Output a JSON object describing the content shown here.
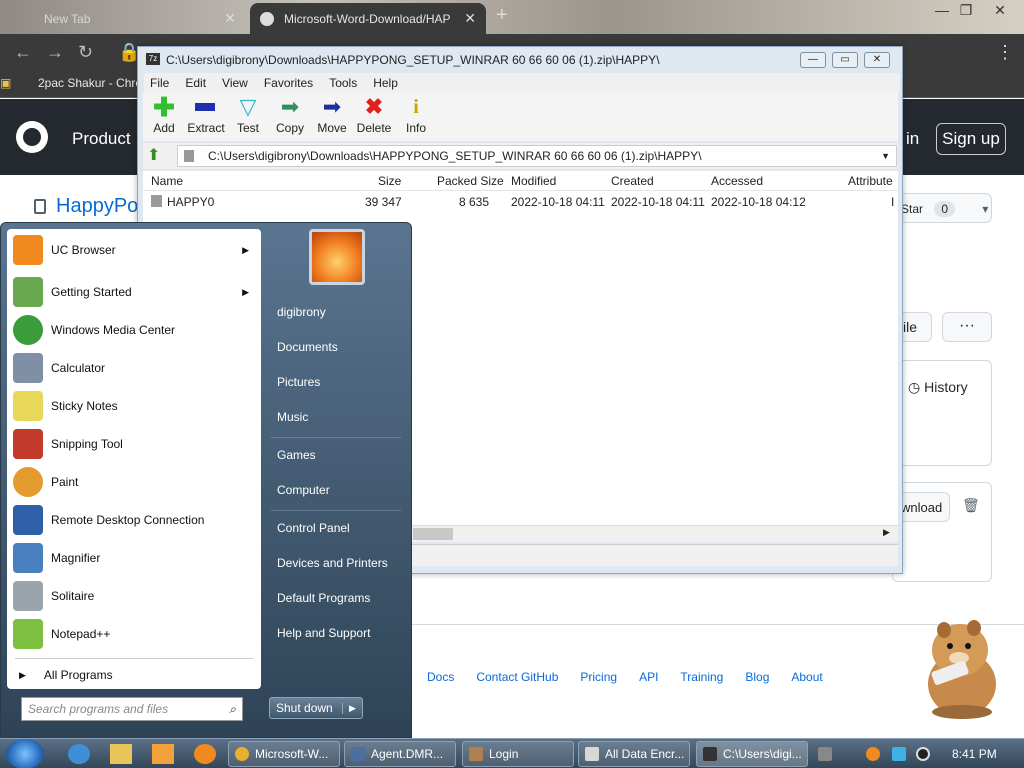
{
  "browser": {
    "tabs": [
      {
        "title": "New Tab"
      },
      {
        "title": "Microsoft-Word-Download/HAP"
      }
    ],
    "bookmarks": [
      {
        "label": "2pac Shakur - Chro"
      }
    ]
  },
  "github": {
    "nav_product": "Product",
    "sign_in": "in",
    "sign_up": "Sign up",
    "repo_name": "HappyPo",
    "star_label": "Star",
    "star_count": "0",
    "file_button": "ile",
    "history": "History",
    "download": "wnload",
    "footer_links": [
      "Docs",
      "Contact GitHub",
      "Pricing",
      "API",
      "Training",
      "Blog",
      "About"
    ]
  },
  "sevenzip": {
    "title": "C:\\Users\\digibrony\\Downloads\\HAPPYPONG_SETUP_WINRAR 60 66 60 06 (1).zip\\HAPPY\\",
    "menu": [
      "File",
      "Edit",
      "View",
      "Favorites",
      "Tools",
      "Help"
    ],
    "tools": [
      {
        "label": "Add",
        "icon": "plus-icon",
        "color": "#2fbf2f"
      },
      {
        "label": "Extract",
        "icon": "minus-icon",
        "color": "#1f2fb0"
      },
      {
        "label": "Test",
        "icon": "check-icon",
        "color": "#2fb8c8"
      },
      {
        "label": "Copy",
        "icon": "copy-arrow-icon",
        "color": "#2f8f5f"
      },
      {
        "label": "Move",
        "icon": "move-arrow-icon",
        "color": "#1f2fa0"
      },
      {
        "label": "Delete",
        "icon": "delete-x-icon",
        "color": "#e01f1f"
      },
      {
        "label": "Info",
        "icon": "info-icon",
        "color": "#c8a800"
      }
    ],
    "address": "C:\\Users\\digibrony\\Downloads\\HAPPYPONG_SETUP_WINRAR 60 66 60 06 (1).zip\\HAPPY\\",
    "columns": [
      "Name",
      "Size",
      "Packed Size",
      "Modified",
      "Created",
      "Accessed",
      "Attribute"
    ],
    "rows": [
      {
        "name": "HAPPY0",
        "size": "39 347",
        "packed": "8 635",
        "modified": "2022-10-18 04:11",
        "created": "2022-10-18 04:11",
        "accessed": "2022-10-18 04:12",
        "attr": "I"
      }
    ]
  },
  "start_menu": {
    "programs": [
      {
        "label": "UC Browser",
        "submenu": true,
        "color": "#f08a1e"
      },
      {
        "label": "Getting Started",
        "submenu": true,
        "color": "#6aa84f"
      },
      {
        "label": "Windows Media Center",
        "submenu": false,
        "color": "#3b9c3b"
      },
      {
        "label": "Calculator",
        "submenu": false,
        "color": "#7f8fa6"
      },
      {
        "label": "Sticky Notes",
        "submenu": false,
        "color": "#e8d85a"
      },
      {
        "label": "Snipping Tool",
        "submenu": false,
        "color": "#c0392b"
      },
      {
        "label": "Paint",
        "submenu": false,
        "color": "#e39b2f"
      },
      {
        "label": "Remote Desktop Connection",
        "submenu": false,
        "color": "#2f5fa8"
      },
      {
        "label": "Magnifier",
        "submenu": false,
        "color": "#4a7fc0"
      },
      {
        "label": "Solitaire",
        "submenu": false,
        "color": "#9aa4ad"
      },
      {
        "label": "Notepad++",
        "submenu": false,
        "color": "#7dbf3f"
      }
    ],
    "all_programs": "All Programs",
    "search_placeholder": "Search programs and files",
    "right_items": [
      "digibrony",
      "Documents",
      "Pictures",
      "Music",
      "Games",
      "Computer",
      "Control Panel",
      "Devices and Printers",
      "Default Programs",
      "Help and Support"
    ],
    "shutdown": "Shut down"
  },
  "taskbar": {
    "buttons": [
      {
        "label": "Microsoft-W...",
        "color": "#e8b02f"
      },
      {
        "label": "Agent.DMR...",
        "color": "#4a6fa0"
      },
      {
        "label": "Login",
        "color": "#b08050"
      },
      {
        "label": "All Data Encr...",
        "color": "#d8d8d8"
      },
      {
        "label": "C:\\Users\\digi...",
        "color": "#333333"
      }
    ],
    "clock": "8:41 PM"
  }
}
